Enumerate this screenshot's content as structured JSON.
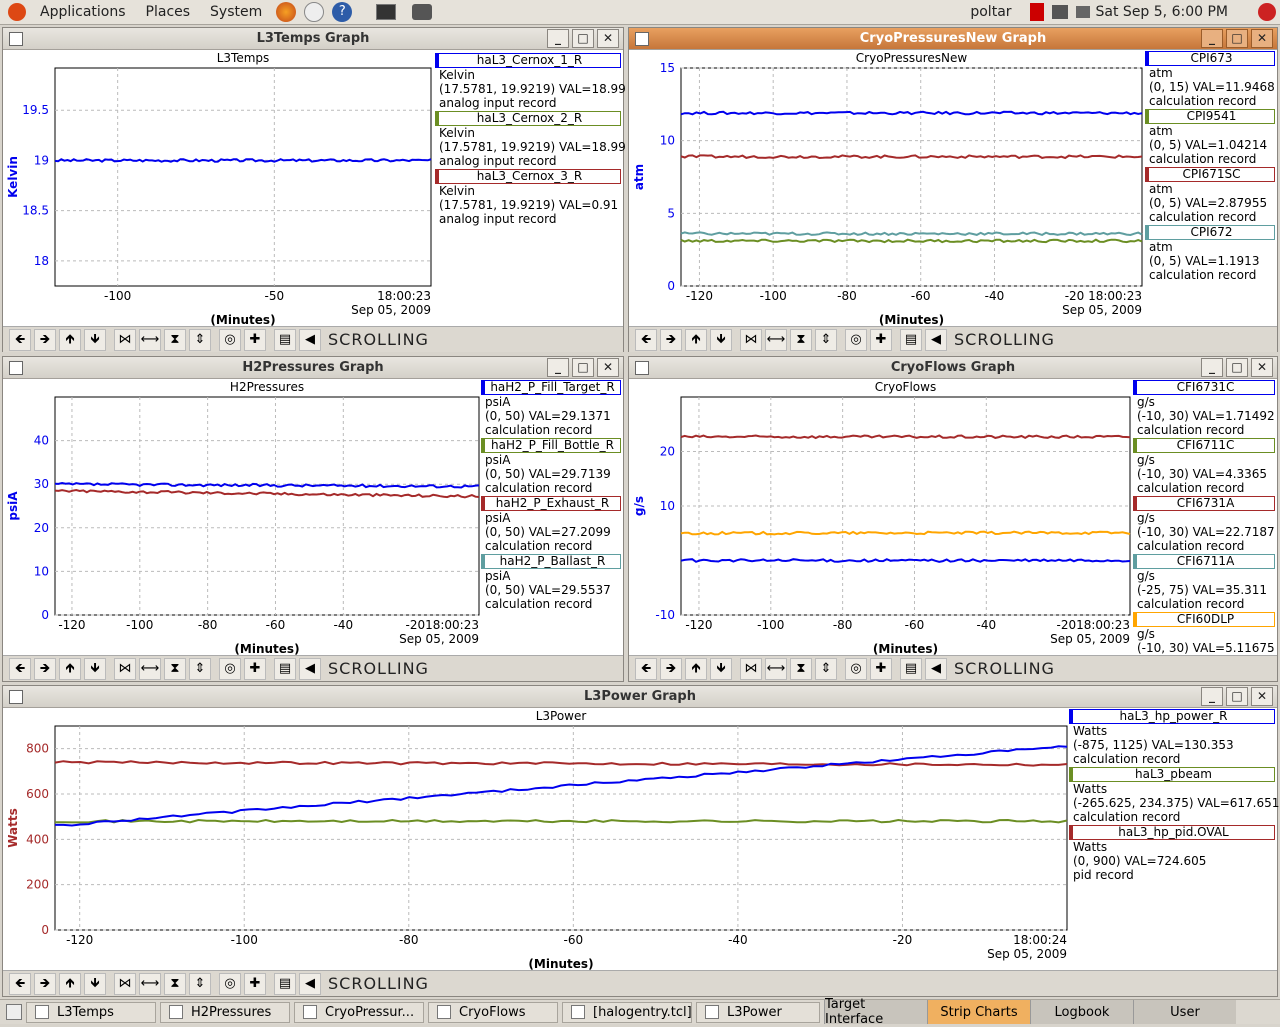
{
  "topbar": {
    "menus": [
      "Applications",
      "Places",
      "System"
    ],
    "user": "poltar",
    "clock": "Sat Sep  5,  6:00 PM"
  },
  "windows": [
    {
      "id": "l3temps",
      "title": "L3Temps Graph",
      "plot_title": "L3Temps",
      "ylabel": "Kelvin",
      "xlabel": "(Minutes)",
      "time": "18:00:23",
      "date": "Sep 05, 2009",
      "legend": [
        {
          "name": "haL3_Cernox_1_R",
          "color": "#0000ee",
          "unit": "Kelvin",
          "range": "(17.5781, 19.9219) VAL=18.99",
          "rec": "analog input record"
        },
        {
          "name": "haL3_Cernox_2_R",
          "color": "#6b8e23",
          "unit": "Kelvin",
          "range": "(17.5781, 19.9219) VAL=18.99",
          "rec": "analog input record"
        },
        {
          "name": "haL3_Cernox_3_R",
          "color": "#a52a2a",
          "unit": "Kelvin",
          "range": "(17.5781, 19.9219) VAL=0.91",
          "rec": "analog input record"
        }
      ]
    },
    {
      "id": "cryopress",
      "title": "CryoPressuresNew Graph",
      "plot_title": "CryoPressuresNew",
      "ylabel": "atm",
      "xlabel": "(Minutes)",
      "time": "-20 18:00:23",
      "date": "Sep 05, 2009",
      "legend": [
        {
          "name": "CPI673",
          "color": "#0000ee",
          "unit": "atm",
          "range": "(0, 15) VAL=11.9468",
          "rec": "calculation record"
        },
        {
          "name": "CPI9541",
          "color": "#6b8e23",
          "unit": "atm",
          "range": "(0, 5) VAL=1.04214",
          "rec": "calculation record"
        },
        {
          "name": "CPI671SC",
          "color": "#a52a2a",
          "unit": "atm",
          "range": "(0, 5) VAL=2.87955",
          "rec": "calculation record"
        },
        {
          "name": "CPI672",
          "color": "#5f9ea0",
          "unit": "atm",
          "range": "(0, 5) VAL=1.1913",
          "rec": "calculation record"
        }
      ]
    },
    {
      "id": "h2press",
      "title": "H2Pressures Graph",
      "plot_title": "H2Pressures",
      "ylabel": "psiA",
      "xlabel": "(Minutes)",
      "time": "-2018:00:23",
      "date": "Sep 05, 2009",
      "legend": [
        {
          "name": "haH2_P_Fill_Target_R",
          "color": "#0000ee",
          "unit": "psiA",
          "range": "(0, 50) VAL=29.1371",
          "rec": "calculation record"
        },
        {
          "name": "haH2_P_Fill_Bottle_R",
          "color": "#6b8e23",
          "unit": "psiA",
          "range": "(0, 50) VAL=29.7139",
          "rec": "calculation record"
        },
        {
          "name": "haH2_P_Exhaust_R",
          "color": "#a52a2a",
          "unit": "psiA",
          "range": "(0, 50) VAL=27.2099",
          "rec": "calculation record"
        },
        {
          "name": "haH2_P_Ballast_R",
          "color": "#5f9ea0",
          "unit": "psiA",
          "range": "(0, 50) VAL=29.5537",
          "rec": "calculation record"
        }
      ]
    },
    {
      "id": "cryoflows",
      "title": "CryoFlows Graph",
      "plot_title": "CryoFlows",
      "ylabel": "g/s",
      "xlabel": "(Minutes)",
      "time": "-2018:00:23",
      "date": "Sep 05, 2009",
      "legend": [
        {
          "name": "CFI6731C",
          "color": "#0000ee",
          "unit": "g/s",
          "range": "(-10, 30) VAL=1.71492",
          "rec": "calculation record"
        },
        {
          "name": "CFI6711C",
          "color": "#6b8e23",
          "unit": "g/s",
          "range": "(-10, 30) VAL=4.3365",
          "rec": "calculation record"
        },
        {
          "name": "CFI6731A",
          "color": "#a52a2a",
          "unit": "g/s",
          "range": "(-10, 30) VAL=22.7187",
          "rec": "calculation record"
        },
        {
          "name": "CFI6711A",
          "color": "#5f9ea0",
          "unit": "g/s",
          "range": "(-25, 75) VAL=35.311",
          "rec": "calculation record"
        },
        {
          "name": "CFI60DLP",
          "color": "#ffa500",
          "unit": "g/s",
          "range": "(-10, 30) VAL=5.11675",
          "rec": "calculation record"
        }
      ]
    },
    {
      "id": "l3power",
      "title": "L3Power Graph",
      "plot_title": "L3Power",
      "ylabel": "Watts",
      "xlabel": "(Minutes)",
      "time": "18:00:24",
      "date": "Sep 05, 2009",
      "legend": [
        {
          "name": "haL3_hp_power_R",
          "color": "#0000ee",
          "unit": "Watts",
          "range": "(-875, 1125) VAL=130.353",
          "rec": "calculation record"
        },
        {
          "name": "haL3_pbeam",
          "color": "#6b8e23",
          "unit": "Watts",
          "range": "(-265.625, 234.375) VAL=617.651",
          "rec": "calculation record"
        },
        {
          "name": "haL3_hp_pid.OVAL",
          "color": "#a52a2a",
          "unit": "Watts",
          "range": "(0, 900) VAL=724.605",
          "rec": "pid record"
        }
      ]
    }
  ],
  "toolbar": {
    "mode": "SCROLLING"
  },
  "taskbar": {
    "tasks": [
      "L3Temps",
      "H2Pressures",
      "CryoPressur...",
      "CryoFlows",
      "[halogentry.tcl]",
      "L3Power"
    ],
    "tabs": [
      "Target Interface",
      "Strip Charts",
      "Logbook",
      "User"
    ],
    "selected_tab": "Strip Charts"
  },
  "chart_data": [
    {
      "type": "line",
      "title": "L3Temps",
      "ylabel": "Kelvin",
      "xlabel": "(Minutes)",
      "ylim": [
        17.75,
        19.92
      ],
      "xlim": [
        -120,
        0
      ],
      "yticks": [
        18,
        18.5,
        19,
        19.5
      ],
      "xticks": [
        -100,
        -50
      ],
      "series": [
        {
          "name": "haL3_Cernox_1_R",
          "values": [
            19,
            19,
            19,
            19
          ]
        }
      ]
    },
    {
      "type": "line",
      "title": "CryoPressuresNew",
      "ylabel": "atm",
      "xlabel": "(Minutes)",
      "ylim": [
        0,
        15
      ],
      "xlim": [
        -125,
        0
      ],
      "yticks": [
        0,
        5,
        10,
        15
      ],
      "xticks": [
        -120,
        -100,
        -80,
        -60,
        -40
      ],
      "series": [
        {
          "name": "CPI673",
          "values": [
            11.9,
            11.9
          ]
        },
        {
          "name": "CPI671SC",
          "values": [
            8.9,
            8.9
          ]
        },
        {
          "name": "CPI672",
          "values": [
            3.6,
            3.6
          ]
        },
        {
          "name": "CPI9541",
          "values": [
            3.1,
            3.1
          ]
        }
      ]
    },
    {
      "type": "line",
      "title": "H2Pressures",
      "ylabel": "psiA",
      "xlabel": "(Minutes)",
      "ylim": [
        0,
        50
      ],
      "xlim": [
        -125,
        0
      ],
      "yticks": [
        0,
        10,
        20,
        30,
        40
      ],
      "xticks": [
        -120,
        -100,
        -80,
        -60,
        -40
      ],
      "series": [
        {
          "name": "haH2_P_Fill_Target_R",
          "values": [
            30,
            29.5
          ]
        },
        {
          "name": "haH2_P_Exhaust_R",
          "values": [
            28.5,
            27.2
          ]
        }
      ]
    },
    {
      "type": "line",
      "title": "CryoFlows",
      "ylabel": "g/s",
      "xlabel": "(Minutes)",
      "ylim": [
        -10,
        30
      ],
      "xlim": [
        -125,
        0
      ],
      "yticks": [
        -10,
        10,
        20
      ],
      "xticks": [
        -120,
        -100,
        -80,
        -60,
        -40
      ],
      "series": [
        {
          "name": "CFI6731A",
          "values": [
            22.7,
            22.7
          ]
        },
        {
          "name": "CFI60DLP",
          "values": [
            5,
            5.1
          ]
        },
        {
          "name": "CFI6731C",
          "values": [
            0,
            0
          ]
        }
      ]
    },
    {
      "type": "line",
      "title": "L3Power",
      "ylabel": "Watts",
      "xlabel": "(Minutes)",
      "ylim": [
        0,
        900
      ],
      "xlim": [
        -123,
        0
      ],
      "yticks": [
        0,
        200,
        400,
        600,
        800
      ],
      "xticks": [
        -120,
        -100,
        -80,
        -60,
        -40,
        -20
      ],
      "series": [
        {
          "name": "haL3_pbeam",
          "values": [
            480,
            480
          ]
        },
        {
          "name": "haL3_hp_pid.OVAL",
          "values": [
            740,
            730
          ]
        },
        {
          "name": "haL3_hp_power_R",
          "values": [
            460,
            810
          ]
        }
      ]
    }
  ]
}
